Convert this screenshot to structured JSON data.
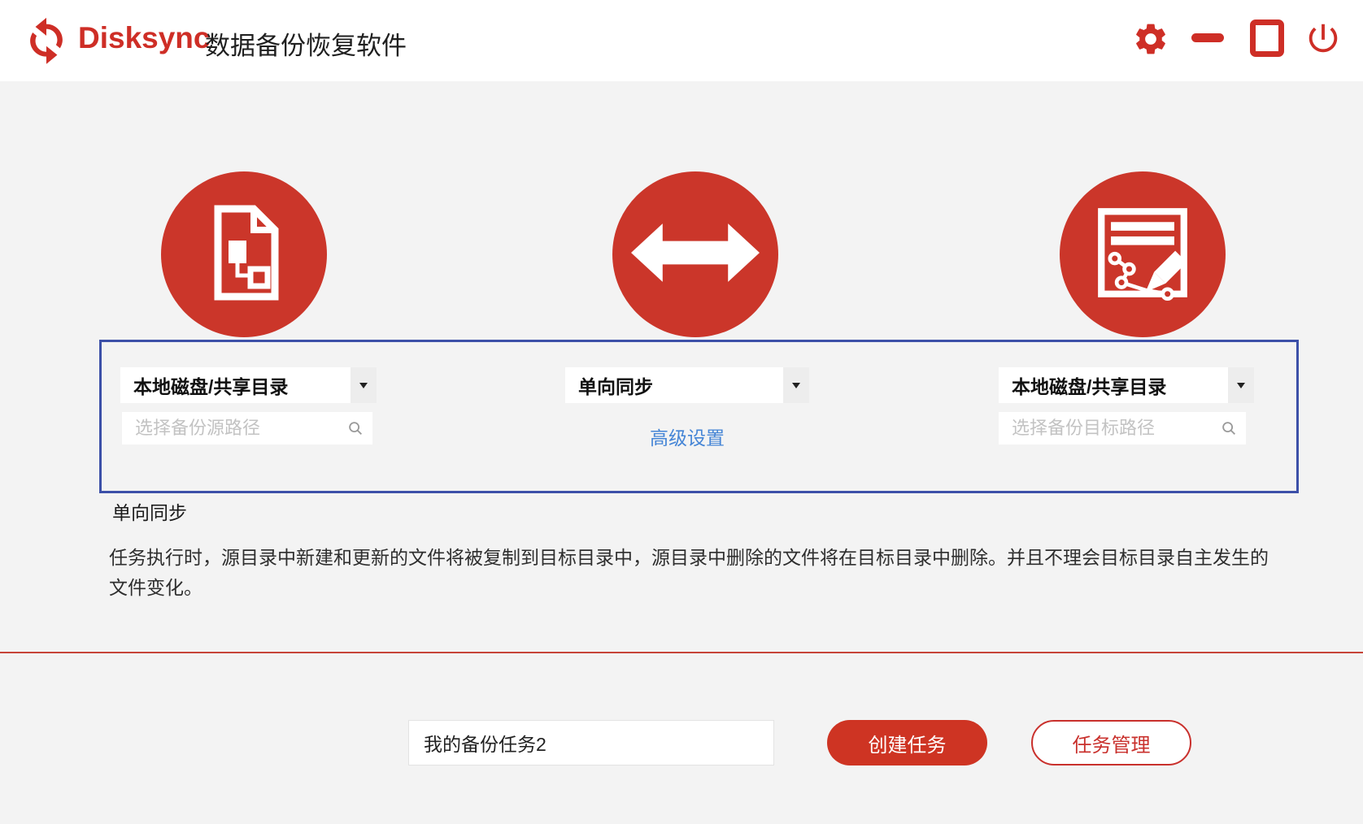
{
  "header": {
    "brand": "Disksync",
    "title": "数据备份恢复软件",
    "controls": [
      {
        "icon": "settings-gear-icon"
      },
      {
        "icon": "minimize-icon"
      },
      {
        "icon": "maximize-icon"
      },
      {
        "icon": "power-icon"
      }
    ]
  },
  "wizard": {
    "source": {
      "type_selected": "本地磁盘/共享目录",
      "path_placeholder": "选择备份源路径",
      "path_value": "",
      "icon": "source-document-flowchart-icon"
    },
    "mode": {
      "type_selected": "单向同步",
      "advanced_link": "高级设置",
      "icon": "two-way-arrow-icon"
    },
    "target": {
      "type_selected": "本地磁盘/共享目录",
      "path_placeholder": "选择备份目标路径",
      "path_value": "",
      "icon": "target-document-edit-icon"
    }
  },
  "mode_info": {
    "title": "单向同步",
    "description": "任务执行时，源目录中新建和更新的文件将被复制到目标目录中，源目录中删除的文件将在目标目录中删除。并且不理会目标目录自主发生的文件变化。"
  },
  "footer": {
    "task_name_value": "我的备份任务2",
    "create_button": "创建任务",
    "manage_button": "任务管理"
  },
  "colors": {
    "brand_red": "#ce2e26",
    "circle_red": "#cb362a",
    "selection_border_blue": "#3c50a8",
    "link_blue": "#4585d6",
    "background_gray": "#f3f3f3",
    "button_red": "#ce3423"
  }
}
